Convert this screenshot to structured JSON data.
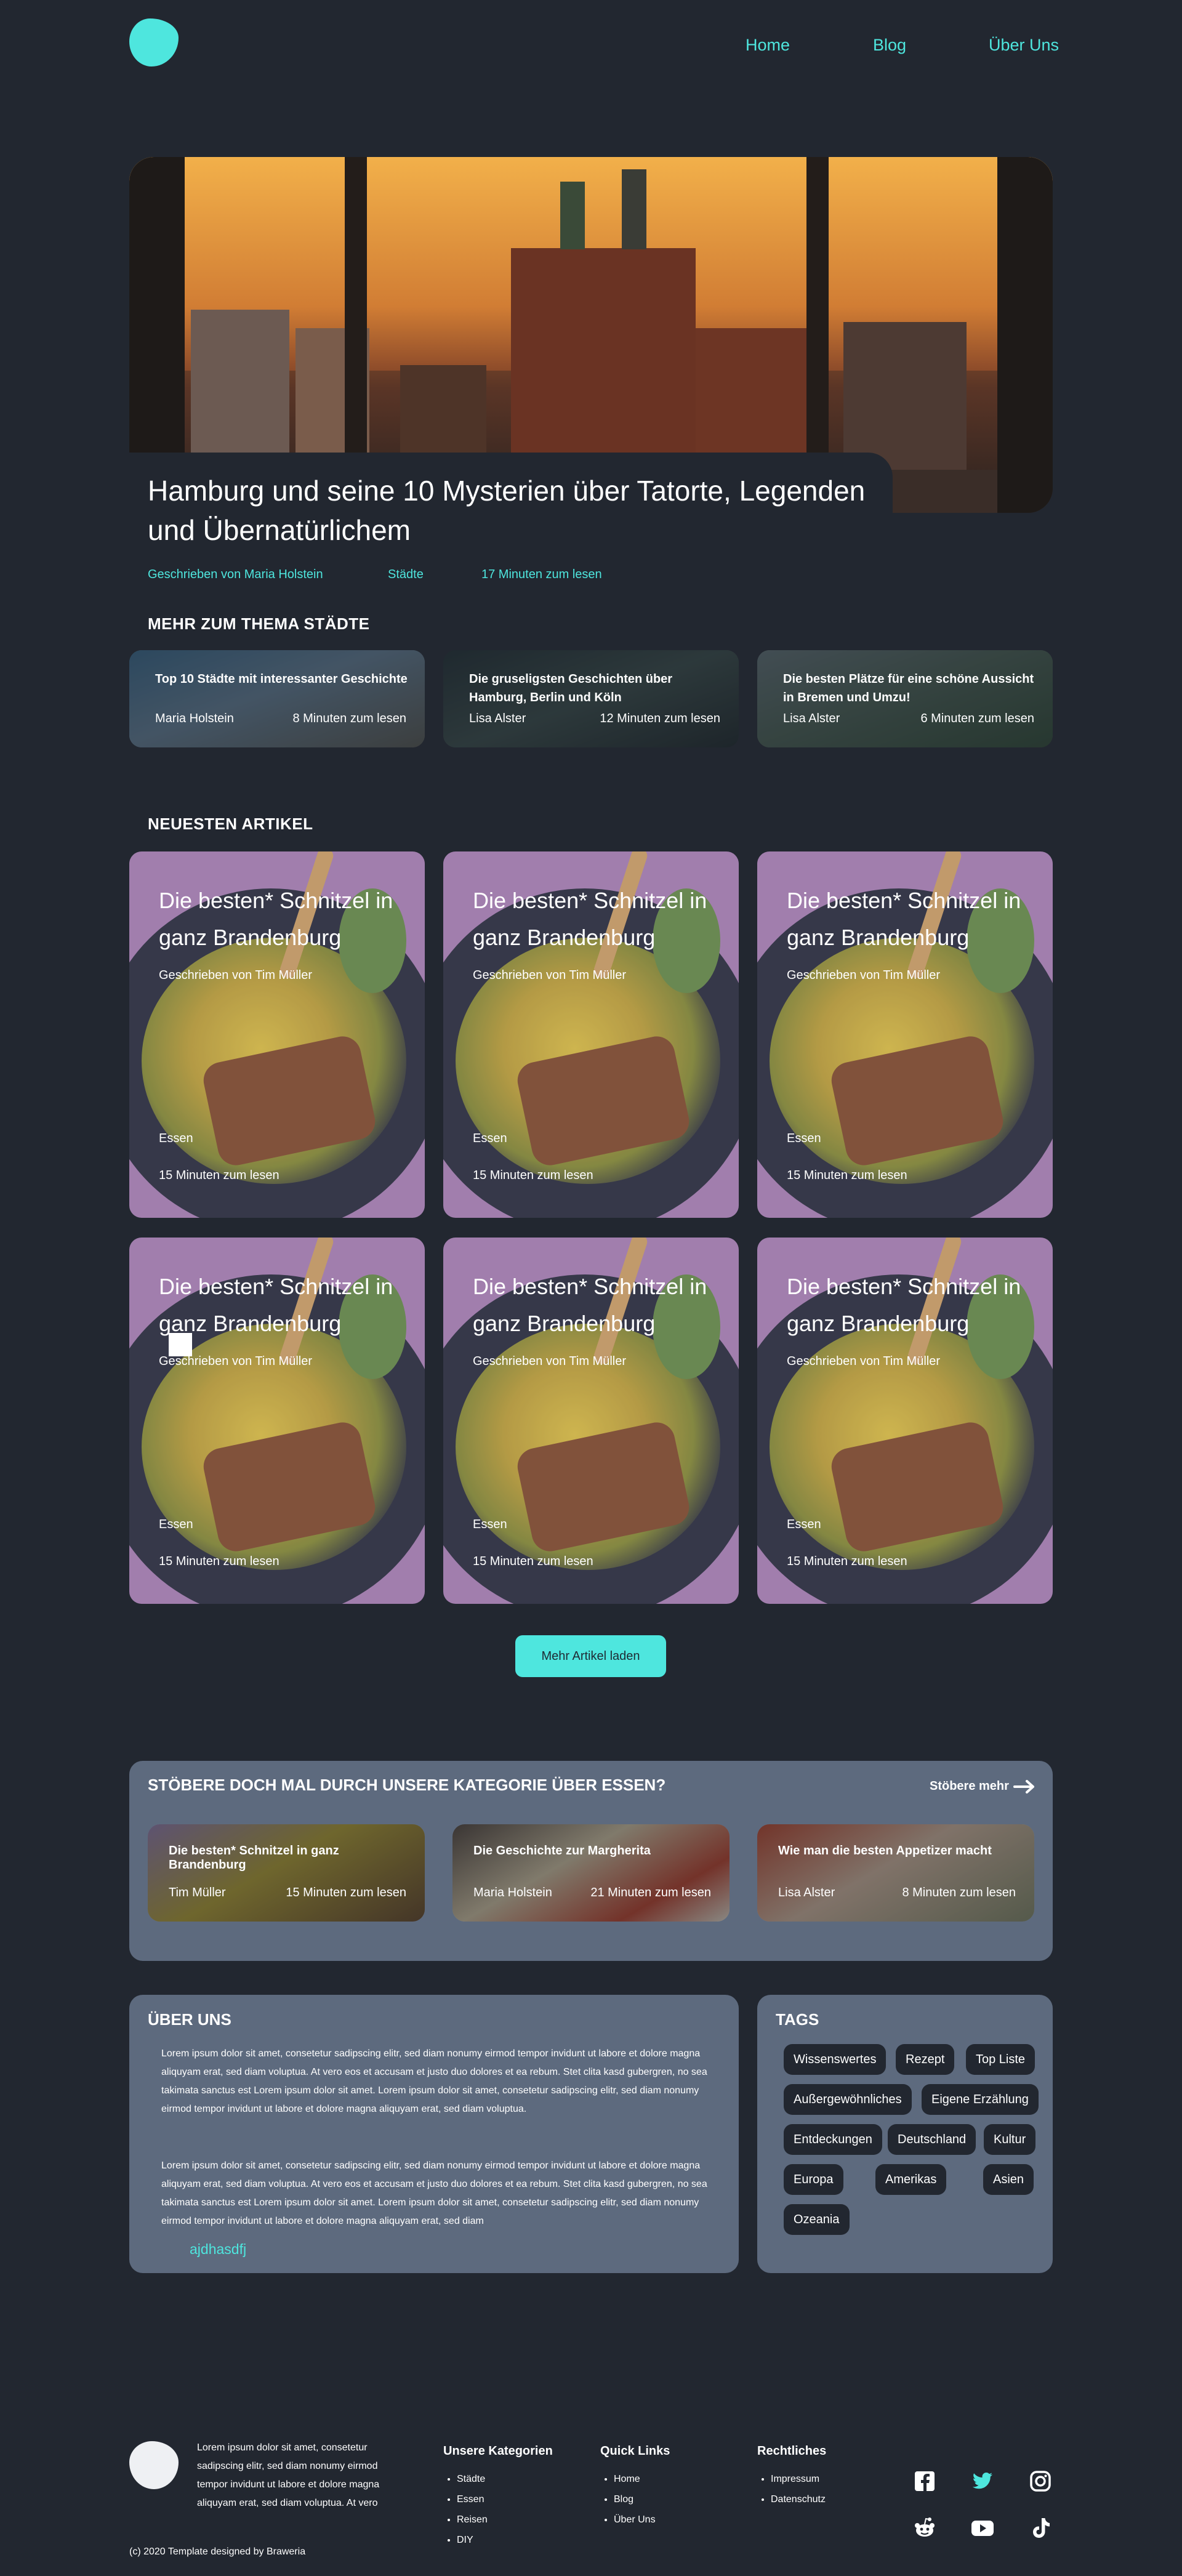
{
  "nav": {
    "home": "Home",
    "blog": "Blog",
    "about": "Über Uns"
  },
  "hero": {
    "title": "Hamburg und seine 10 Mysterien über Tatorte, Legenden und Übernatürlichem",
    "author": "Geschrieben von Maria Holstein",
    "category": "Städte",
    "read_time": "17 Minuten zum lesen"
  },
  "related": {
    "heading": "MEHR ZUM THEMA STÄDTE",
    "cards": [
      {
        "title": "Top 10 Städte mit interessanter Geschichte",
        "author": "Maria Holstein",
        "time": "8 Minuten zum lesen"
      },
      {
        "title": "Die gruseligsten Geschichten über Hamburg, Berlin und Köln",
        "author": "Lisa Alster",
        "time": "12 Minuten zum lesen"
      },
      {
        "title": "Die besten Plätze für eine schöne Aussicht in Bremen und Umzu!",
        "author": "Lisa Alster",
        "time": "6 Minuten zum lesen"
      }
    ]
  },
  "latest": {
    "heading": "NEUESTEN ARTIKEL",
    "cards": [
      {
        "title": "Die besten* Schnitzel in ganz Brandenburg",
        "author": "Geschrieben von Tim Müller",
        "category": "Essen",
        "time": "15 Minuten zum lesen"
      },
      {
        "title": "Die besten* Schnitzel in ganz Brandenburg",
        "author": "Geschrieben von Tim Müller",
        "category": "Essen",
        "time": "15 Minuten zum lesen"
      },
      {
        "title": "Die besten* Schnitzel in ganz Brandenburg",
        "author": "Geschrieben von Tim Müller",
        "category": "Essen",
        "time": "15 Minuten zum lesen"
      },
      {
        "title": "Die besten* Schnitzel in ganz Brandenburg",
        "author": "Geschrieben von Tim Müller",
        "category": "Essen",
        "time": "15 Minuten zum lesen"
      },
      {
        "title": "Die besten* Schnitzel in ganz Brandenburg",
        "author": "Geschrieben von Tim Müller",
        "category": "Essen",
        "time": "15 Minuten zum lesen"
      },
      {
        "title": "Die besten* Schnitzel in ganz Brandenburg",
        "author": "Geschrieben von Tim Müller",
        "category": "Essen",
        "time": "15 Minuten zum lesen"
      }
    ],
    "load_more": "Mehr Artikel laden"
  },
  "category_panel": {
    "heading": "STÖBERE DOCH MAL DURCH UNSERE KATEGORIE ÜBER ESSEN?",
    "more": "Stöbere mehr",
    "cards": [
      {
        "title": "Die besten* Schnitzel in ganz Brandenburg",
        "author": "Tim Müller",
        "time": "15 Minuten zum lesen"
      },
      {
        "title": "Die Geschichte zur Margherita",
        "author": "Maria Holstein",
        "time": "21 Minuten zum lesen"
      },
      {
        "title": "Wie man die besten Appetizer macht",
        "author": "Lisa Alster",
        "time": "8 Minuten zum lesen"
      }
    ]
  },
  "about": {
    "heading": "ÜBER UNS",
    "p1": "Lorem ipsum dolor sit amet, consetetur sadipscing elitr, sed diam nonumy eirmod tempor invidunt ut labore et dolore magna aliquyam erat, sed diam voluptua. At vero eos et accusam et justo duo dolores et ea rebum. Stet clita kasd gubergren, no sea takimata sanctus est Lorem ipsum dolor sit amet. Lorem ipsum dolor sit amet, consetetur sadipscing elitr, sed diam nonumy eirmod tempor invidunt ut labore et dolore magna aliquyam erat, sed diam voluptua.",
    "p2": "Lorem ipsum dolor sit amet, consetetur sadipscing elitr, sed diam nonumy eirmod tempor invidunt ut labore et dolore magna aliquyam erat, sed diam voluptua. At vero eos et accusam et justo duo dolores et ea rebum. Stet clita kasd gubergren, no sea takimata sanctus est Lorem ipsum dolor sit amet. Lorem ipsum dolor sit amet, consetetur sadipscing elitr, sed diam nonumy eirmod tempor invidunt ut labore et dolore magna aliquyam erat, sed diam",
    "link": "ajdhasdfj"
  },
  "tags": {
    "heading": "TAGS",
    "items": [
      "Wissenswertes",
      "Rezept",
      "Top Liste",
      "Außergewöhnliches",
      "Eigene Erzählung",
      "Entdeckungen",
      "Deutschland",
      "Kultur",
      "Europa",
      "Amerikas",
      "Asien",
      "Ozeania"
    ]
  },
  "footer": {
    "blurb": "Lorem ipsum dolor sit amet, consetetur sadipscing elitr, sed diam nonumy eirmod tempor invidunt ut labore et dolore magna aliquyam erat, sed diam voluptua. At vero",
    "col1": {
      "heading": "Unsere Kategorien",
      "items": [
        "Städte",
        "Essen",
        "Reisen",
        "DIY"
      ]
    },
    "col2": {
      "heading": "Quick Links",
      "items": [
        "Home",
        "Blog",
        "Über Uns"
      ]
    },
    "col3": {
      "heading": "Rechtliches",
      "items": [
        "Impressum",
        "Datenschutz"
      ]
    },
    "copyright": "(c) 2020 Template designed by Braweria",
    "social_icons": [
      "facebook-icon",
      "twitter-icon",
      "instagram-icon",
      "reddit-icon",
      "youtube-icon",
      "tiktok-icon"
    ]
  },
  "colors": {
    "accent": "#4ee6de",
    "background": "#222730",
    "panel": "#5d6a7e",
    "card_purple": "#a27fad"
  }
}
